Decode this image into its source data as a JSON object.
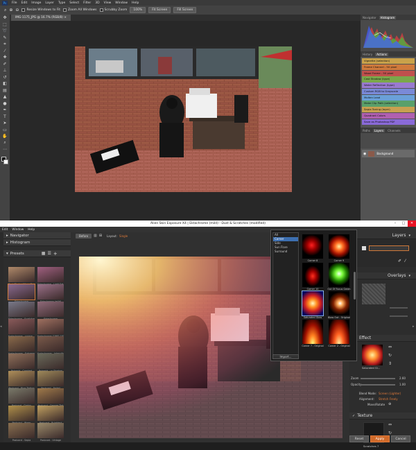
{
  "photoshop": {
    "logo": "Ps",
    "menu": [
      "File",
      "Edit",
      "Image",
      "Layer",
      "Type",
      "Select",
      "Filter",
      "3D",
      "View",
      "Window",
      "Help"
    ],
    "options": {
      "resize_label": "Resize Windows to Fit",
      "zoom_all_label": "Zoom All Windows",
      "scrubby_label": "Scrubby Zoom",
      "zoom_100": "100%",
      "fit_screen": "Fit Screen",
      "fill_screen": "Fill Screen"
    },
    "doc_tab": "IMG-1175_JPG @ 16.7% (RGB/8) ×",
    "panels": {
      "top_tabs": [
        "Navigator",
        "Histogram"
      ],
      "mid_tabs": [
        "History",
        "Actions"
      ],
      "actions": [
        {
          "label": "Vignette (selection)",
          "color": "#c9a24a"
        },
        {
          "label": "Frame Channel - 50 pixel",
          "color": "#d07a3c"
        },
        {
          "label": "Wood Frame - 50 pixel",
          "color": "#c0504d"
        },
        {
          "label": "Cast Shadow (type)",
          "color": "#7aa84a"
        },
        {
          "label": "Water Reflection (type)",
          "color": "#9a7ad0"
        },
        {
          "label": "Custom RGB to Grayscale",
          "color": "#7a8ad8"
        },
        {
          "label": "Molten Lead",
          "color": "#6aa0d8"
        },
        {
          "label": "Make Clip Path (selection)",
          "color": "#5aa06a"
        },
        {
          "label": "Sepia Toning (layer)",
          "color": "#c8a050"
        },
        {
          "label": "Quadrant Colors",
          "color": "#b060b0"
        },
        {
          "label": "Save as Photoshop PDF",
          "color": "#8a6ad8"
        }
      ],
      "bottom_tabs": [
        "Paths",
        "Layers",
        "Channels"
      ],
      "layer_name": "Background"
    }
  },
  "exposure": {
    "title": "Alien Skin Exposure X4 | Ektachrome (mild) - Dust & Scratches (modified)",
    "menu": [
      "Edit",
      "Window",
      "Help"
    ],
    "left": {
      "navigator": "Navigator",
      "histogram": "Histogram",
      "presets": "Presets",
      "preset_labels": [
        "Dust Photo - Warm Em...",
        "Ektachrome - Light Eating",
        "Ektachrome",
        "Ektachrome (mild)",
        "Ektachrome - Scratches",
        "Ektachrome",
        "Kodachrome - coarse...",
        "Kodachrome (1960-1970)",
        "Kodachrome - Extreme",
        "Kodachrome - Intensify",
        "Polaroid - Cranked",
        "Polaroid - ur Shadow",
        "Postcard - Blue Tinting",
        "Postcard - Faded",
        "Postcard - Grainy",
        "Postcard - Orange Tint",
        "Postcard - Warm",
        "Postcard - Brightest",
        "Postcard - Sepia",
        "Postcard - Vintage"
      ]
    },
    "center": {
      "before_label": "Before",
      "layout_label": "Layout:",
      "layout_value": "Single"
    },
    "overlay_popup": {
      "categories": [
        "All",
        "Corner",
        "Side",
        "Sun Flare",
        "Surround"
      ],
      "selected_category": "Corner",
      "import_label": "Import...",
      "items": [
        "Corner 8",
        "Corner 9",
        "Corner 10",
        "Out Of Focus Green",
        "Saturated Glow",
        "Blow Out - Original",
        "Corner 7 - Original",
        "Corner 2 - Original"
      ],
      "selected_item": "Saturated Glow"
    },
    "right": {
      "layers": "Layers",
      "overlays": "Overlays",
      "effect": "Effect",
      "overlay_name": "Saturated Gl...",
      "zoom_label": "Zoom",
      "zoom_value": "2.60",
      "opacity_label": "Opacity",
      "opacity_value": "1.00",
      "blend_label": "Blend Mode:",
      "blend_value": "Screen (Lighter)",
      "alignment_label": "Alignment:",
      "alignment_value": "Stretch Freely",
      "move_label": "Move/Rotate",
      "texture": "Texture",
      "texture_name": "Scratches 7",
      "reset": "Reset",
      "apply": "Apply",
      "cancel": "Cancel"
    }
  }
}
